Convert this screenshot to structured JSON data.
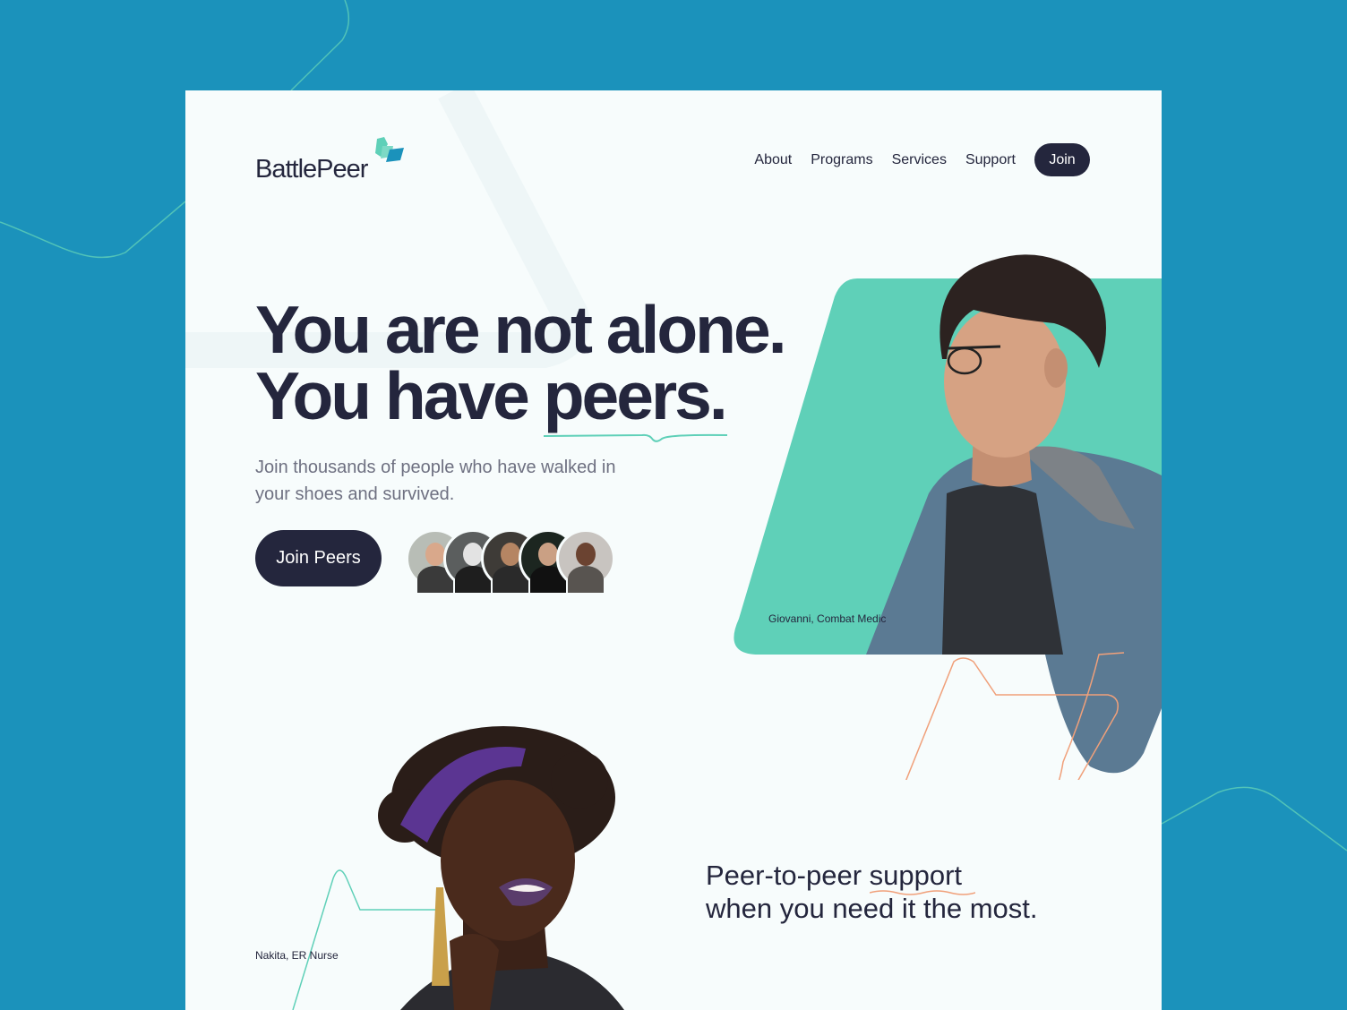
{
  "brand": {
    "name": "BattlePeer",
    "logo_icon": "flag-chevron-icon",
    "colors": {
      "navy": "#24263d",
      "teal": "#5fd0b8",
      "blue": "#1b92bb",
      "orange": "#f0a07a"
    }
  },
  "nav": {
    "links": [
      {
        "label": "About"
      },
      {
        "label": "Programs"
      },
      {
        "label": "Services"
      },
      {
        "label": "Support"
      }
    ],
    "join_label": "Join"
  },
  "hero": {
    "headline_line1": "You are not alone.",
    "headline_line2_prefix": "You have ",
    "headline_line2_emphasis": "peers.",
    "subtitle": "Join thousands of people who have walked in your shoes and survived.",
    "cta_label": "Join Peers",
    "peer_avatar_count": 5
  },
  "featured_people": [
    {
      "caption": "Giovanni, Combat Medic"
    },
    {
      "caption": "Nakita, ER Nurse"
    }
  ],
  "section2": {
    "line1_prefix": "Peer-to-peer ",
    "line1_emphasis": "support",
    "line2": "when you need it the most."
  }
}
